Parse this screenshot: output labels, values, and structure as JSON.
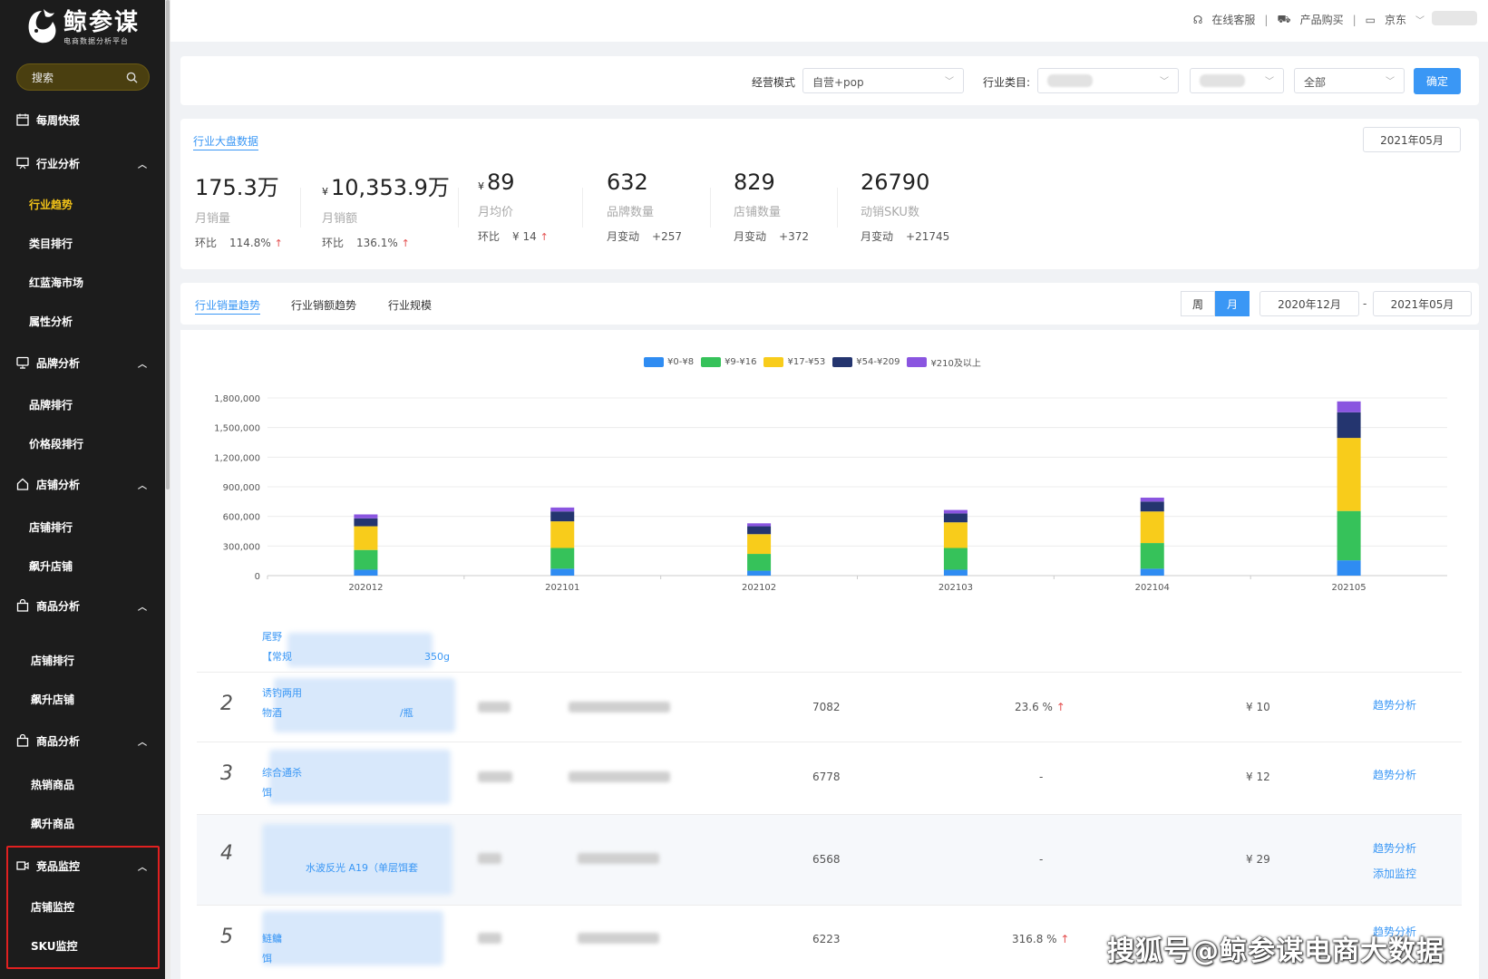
{
  "brand": {
    "title": "鲸参谋",
    "subtitle": "电商数据分析平台"
  },
  "search": {
    "placeholder": "搜索"
  },
  "sidebar": {
    "items": [
      {
        "label": "每周快报",
        "icon": "calendar-icon",
        "type": "group"
      },
      {
        "label": "行业分析",
        "icon": "chart-board-icon",
        "type": "group",
        "expanded": true
      },
      {
        "label": "行业趋势",
        "type": "sub",
        "active": true
      },
      {
        "label": "类目排行",
        "type": "sub"
      },
      {
        "label": "红蓝海市场",
        "type": "sub"
      },
      {
        "label": "属性分析",
        "type": "sub"
      },
      {
        "label": "品牌分析",
        "icon": "monitor-icon",
        "type": "group",
        "expanded": true
      },
      {
        "label": "品牌排行",
        "type": "sub"
      },
      {
        "label": "价格段排行",
        "type": "sub"
      },
      {
        "label": "店铺分析",
        "icon": "home-icon",
        "type": "group",
        "expanded": true
      },
      {
        "label": "店铺排行",
        "type": "sub"
      },
      {
        "label": "飙升店铺",
        "type": "sub"
      },
      {
        "label": "商品分析",
        "icon": "bag-icon",
        "type": "group",
        "expanded": true
      },
      {
        "label": "店铺排行",
        "type": "sub"
      },
      {
        "label": "飙升店铺",
        "type": "sub"
      },
      {
        "label": "商品分析",
        "icon": "bag-icon",
        "type": "group",
        "expanded": true
      },
      {
        "label": "热销商品",
        "type": "sub"
      },
      {
        "label": "飙升商品",
        "type": "sub"
      },
      {
        "label": "竞品监控",
        "icon": "video-icon",
        "type": "group",
        "expanded": true
      },
      {
        "label": "店铺监控",
        "type": "sub"
      },
      {
        "label": "SKU监控",
        "type": "sub"
      }
    ]
  },
  "topbar": {
    "links": [
      "在线客服",
      "产品购买",
      "京东"
    ]
  },
  "filters": {
    "mode_label": "经营模式",
    "mode_value": "自营+pop",
    "category_label": "行业类目:",
    "third_value": "全部",
    "confirm": "确定"
  },
  "overview": {
    "tab": "行业大盘数据",
    "month": "2021年05月",
    "kpis": [
      {
        "currency": "",
        "value": "175.3万",
        "label": "月销量",
        "cmp_label": "环比",
        "cmp_value": "114.8%",
        "arrow": "↑"
      },
      {
        "currency": "¥",
        "value": "10,353.9万",
        "label": "月销额",
        "cmp_label": "环比",
        "cmp_value": "136.1%",
        "arrow": "↑"
      },
      {
        "currency": "¥",
        "value": "89",
        "label": "月均价",
        "cmp_label": "环比",
        "cmp_value": "¥ 14",
        "arrow": "↑"
      },
      {
        "currency": "",
        "value": "632",
        "label": "品牌数量",
        "cmp_label": "月变动",
        "cmp_value": "+257",
        "arrow": ""
      },
      {
        "currency": "",
        "value": "829",
        "label": "店铺数量",
        "cmp_label": "月变动",
        "cmp_value": "+372",
        "arrow": ""
      },
      {
        "currency": "",
        "value": "26790",
        "label": "动销SKU数",
        "cmp_label": "月变动",
        "cmp_value": "+21745",
        "arrow": ""
      }
    ]
  },
  "trend": {
    "tabs": [
      "行业销量趋势",
      "行业销额趋势",
      "行业规模"
    ],
    "period": [
      "周",
      "月"
    ],
    "start": "2020年12月",
    "dash": "-",
    "end": "2021年05月"
  },
  "chart_data": {
    "type": "bar",
    "stacked": true,
    "categories": [
      "202012",
      "202101",
      "202102",
      "202103",
      "202104",
      "202105"
    ],
    "series": [
      {
        "name": "¥0-¥8",
        "color": "#2f8cf2",
        "values": [
          60000,
          70000,
          50000,
          60000,
          70000,
          155000
        ]
      },
      {
        "name": "¥9-¥16",
        "color": "#36c25a",
        "values": [
          200000,
          210000,
          170000,
          220000,
          260000,
          500000
        ]
      },
      {
        "name": "¥17-¥53",
        "color": "#f8cc1b",
        "values": [
          240000,
          270000,
          200000,
          260000,
          320000,
          740000
        ]
      },
      {
        "name": "¥54-¥209",
        "color": "#24356f",
        "values": [
          80000,
          100000,
          80000,
          90000,
          100000,
          260000
        ]
      },
      {
        "name": "¥210及以上",
        "color": "#8a55e0",
        "values": [
          40000,
          40000,
          30000,
          35000,
          40000,
          110000
        ]
      }
    ],
    "ylim": [
      0,
      1800000
    ],
    "yticks": [
      "0",
      "300,000",
      "600,000",
      "900,000",
      "1,200,000",
      "1,500,000",
      "1,800,000"
    ],
    "grid": true,
    "legend": "top-center"
  },
  "table": {
    "rows": [
      {
        "rank": "",
        "name_lines": [
          "尾野",
          "【常规",
          "350g"
        ],
        "sales": "",
        "growth": "",
        "price": "",
        "actions": []
      },
      {
        "rank": "2",
        "name_lines": [
          "诱钓两用",
          "物酒",
          "/瓶"
        ],
        "sales": "7082",
        "growth": "23.6 %",
        "growth_arrow": "↑",
        "price": "¥ 10",
        "actions": [
          "趋势分析"
        ]
      },
      {
        "rank": "3",
        "name_lines": [
          "综合通杀",
          "饵"
        ],
        "sales": "6778",
        "growth": "-",
        "growth_arrow": "",
        "price": "¥ 12",
        "actions": [
          "趋势分析"
        ]
      },
      {
        "rank": "4",
        "name_lines": [
          "水波反光 A19（单层饵套"
        ],
        "sales": "6568",
        "growth": "-",
        "growth_arrow": "",
        "price": "¥ 29",
        "actions": [
          "趋势分析",
          "添加监控"
        ]
      },
      {
        "rank": "5",
        "name_lines": [
          "饵",
          "鲢鳙"
        ],
        "sales": "6223",
        "growth": "316.8 %",
        "growth_arrow": "↑",
        "price": "",
        "actions": [
          "趋势分析"
        ]
      }
    ]
  },
  "watermark": "搜狐号@鲸参谋电商大数据"
}
